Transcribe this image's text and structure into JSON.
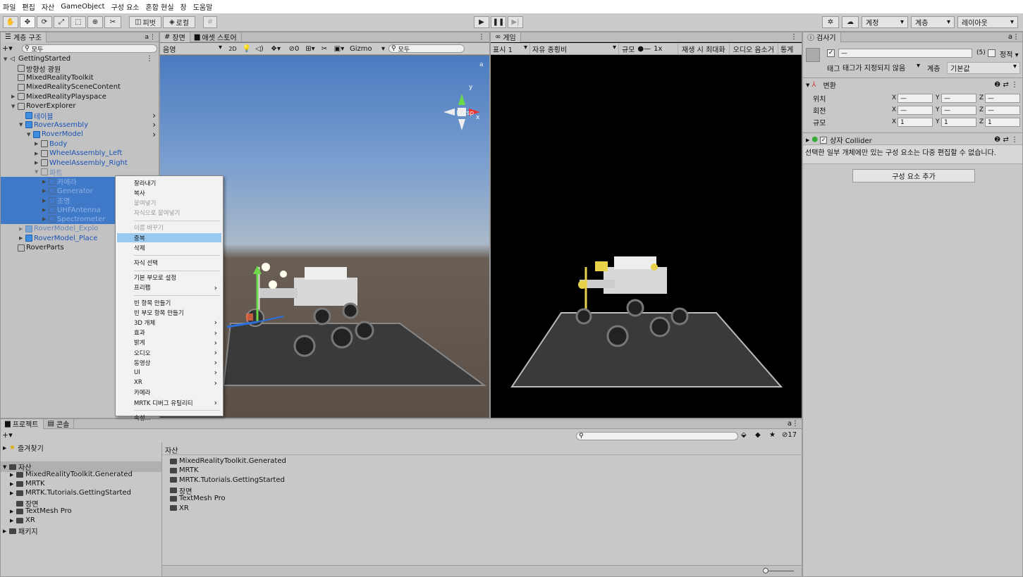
{
  "menubar": [
    "파일",
    "편집",
    "자산",
    "GameObject",
    "구성 요소",
    "혼합 현실",
    "창",
    "도움말"
  ],
  "toolbar": {
    "pivot": "피벗",
    "local": "로컬",
    "account": "계정",
    "layers": "계층",
    "layout": "레이아웃"
  },
  "hierarchy": {
    "tab": "계층 구조",
    "search_placeholder": "모두",
    "items": [
      {
        "label": "GettingStarted",
        "indent": 0,
        "arrow": "▼",
        "type": "scene"
      },
      {
        "label": "방향성 광원",
        "indent": 1,
        "arrow": "",
        "type": "obj"
      },
      {
        "label": "MixedRealityToolkit",
        "indent": 1,
        "arrow": "",
        "type": "obj"
      },
      {
        "label": "MixedRealitySceneContent",
        "indent": 1,
        "arrow": "",
        "type": "obj"
      },
      {
        "label": "MixedRealityPlayspace",
        "indent": 1,
        "arrow": "▶",
        "type": "obj"
      },
      {
        "label": "RoverExplorer",
        "indent": 1,
        "arrow": "▼",
        "type": "obj"
      },
      {
        "label": "테이블",
        "indent": 2,
        "arrow": "",
        "type": "prefab"
      },
      {
        "label": "RoverAssembly",
        "indent": 2,
        "arrow": "▼",
        "type": "prefab"
      },
      {
        "label": "RoverModel",
        "indent": 3,
        "arrow": "▼",
        "type": "prefab"
      },
      {
        "label": "Body",
        "indent": 4,
        "arrow": "▶",
        "type": "pobj"
      },
      {
        "label": "WheelAssembly_Left",
        "indent": 4,
        "arrow": "▶",
        "type": "pobj"
      },
      {
        "label": "WheelAssembly_Right",
        "indent": 4,
        "arrow": "▶",
        "type": "pobj"
      },
      {
        "label": "파트",
        "indent": 4,
        "arrow": "▼",
        "type": "pobjdim"
      },
      {
        "label": "카메라",
        "indent": 5,
        "arrow": "▶",
        "type": "sel"
      },
      {
        "label": "Generator",
        "indent": 5,
        "arrow": "▶",
        "type": "sel"
      },
      {
        "label": "조명",
        "indent": 5,
        "arrow": "▶",
        "type": "sel"
      },
      {
        "label": "UHFAntenna",
        "indent": 5,
        "arrow": "▶",
        "type": "sel"
      },
      {
        "label": "Spectrometer",
        "indent": 5,
        "arrow": "▶",
        "type": "sel"
      },
      {
        "label": "RoverModel_Explo",
        "indent": 2,
        "arrow": "▶",
        "type": "prefabdim"
      },
      {
        "label": "RoverModel_Place",
        "indent": 2,
        "arrow": "▶",
        "type": "prefab"
      },
      {
        "label": "RoverParts",
        "indent": 1,
        "arrow": "",
        "type": "obj"
      }
    ]
  },
  "context_menu": [
    {
      "label": "잘라내기",
      "state": "normal"
    },
    {
      "label": "복사",
      "state": "normal"
    },
    {
      "label": "붙여넣기",
      "state": "disabled"
    },
    {
      "label": "자식으로 붙여넣기",
      "state": "disabled"
    },
    {
      "sep": true
    },
    {
      "label": "이름 바꾸기",
      "state": "disabled"
    },
    {
      "label": "중복",
      "state": "highlight"
    },
    {
      "label": "삭제",
      "state": "normal"
    },
    {
      "sep": true
    },
    {
      "label": "자식 선택",
      "state": "normal"
    },
    {
      "sep": true
    },
    {
      "label": "기본 부모로 설정",
      "state": "normal"
    },
    {
      "label": "프리팹",
      "state": "normal",
      "sub": true
    },
    {
      "sep": true
    },
    {
      "label": "빈 항목 만들기",
      "state": "normal"
    },
    {
      "label": "빈 부모 항목 만들기",
      "state": "normal"
    },
    {
      "label": "3D 개체",
      "state": "normal",
      "sub": true
    },
    {
      "label": "효과",
      "state": "normal",
      "sub": true
    },
    {
      "label": "밝게",
      "state": "normal",
      "sub": true
    },
    {
      "label": "오디오",
      "state": "normal",
      "sub": true
    },
    {
      "label": "동영상",
      "state": "normal",
      "sub": true
    },
    {
      "label": "UI",
      "state": "normal",
      "sub": true
    },
    {
      "label": "XR",
      "state": "normal",
      "sub": true
    },
    {
      "label": "카메라",
      "state": "normal"
    },
    {
      "label": "MRTK 디버그 유틸리티",
      "state": "normal",
      "sub": true
    },
    {
      "sep": true
    },
    {
      "label": "속성...",
      "state": "normal"
    }
  ],
  "scene": {
    "tab": "장면",
    "tab2": "애셋 스토어",
    "shading": "음영",
    "mode2d": "2D",
    "gizmo": "Gizmo",
    "search": "모두",
    "persp": "Persp",
    "hidden_count": "0"
  },
  "game": {
    "tab": "게임",
    "display": "표시 1",
    "aspect": "자유 종횡비",
    "scale_label": "규모",
    "scale_value": "1x",
    "maximize": "재생 시 최대화",
    "mute": "오디오 음소거",
    "stats": "통계"
  },
  "inspector": {
    "tab": "검사기",
    "name_value": "—",
    "count": "(5)",
    "static_label": "정적",
    "tag_label": "태그",
    "tag_value": "태그가 지정되지 않음",
    "layer_label": "계층",
    "layer_value": "기본값",
    "transform": "변환",
    "position": "위치",
    "rotation": "회전",
    "scale": "규모",
    "pos": [
      "—",
      "—",
      "—"
    ],
    "rot": [
      "—",
      "—",
      "—"
    ],
    "scl": [
      "1",
      "1",
      "1"
    ],
    "collider": "상자 Collider",
    "multi_edit_msg": "선택한 일부 개체에만 있는 구성 요소는 다중 편집할 수 없습니다.",
    "add_component": "구성 요소 추가"
  },
  "project": {
    "tab": "프로젝트",
    "tab2": "콘솔",
    "search": "",
    "hidden_count": "17",
    "tree": [
      {
        "label": "즐겨찾기",
        "indent": 0,
        "arrow": "▶",
        "icon": "star"
      },
      {
        "label": "자산",
        "indent": 0,
        "arrow": "▼",
        "icon": "folder"
      },
      {
        "label": "MixedRealityToolkit.Generated",
        "indent": 1,
        "arrow": "▶",
        "icon": "folder"
      },
      {
        "label": "MRTK",
        "indent": 1,
        "arrow": "▶",
        "icon": "folder"
      },
      {
        "label": "MRTK.Tutorials.GettingStarted",
        "indent": 1,
        "arrow": "▶",
        "icon": "folder"
      },
      {
        "label": "장면",
        "indent": 1,
        "arrow": "",
        "icon": "folder"
      },
      {
        "label": "TextMesh Pro",
        "indent": 1,
        "arrow": "▶",
        "icon": "folder"
      },
      {
        "label": "XR",
        "indent": 1,
        "arrow": "▶",
        "icon": "folder"
      },
      {
        "label": "패키지",
        "indent": 0,
        "arrow": "▶",
        "icon": "folder"
      }
    ],
    "breadcrumb": "자산",
    "assets": [
      "MixedRealityToolkit.Generated",
      "MRTK",
      "MRTK.Tutorials.GettingStarted",
      "장면",
      "TextMesh Pro",
      "XR"
    ]
  }
}
